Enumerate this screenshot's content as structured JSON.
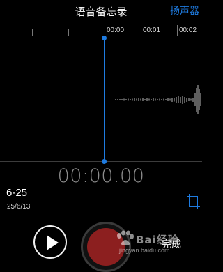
{
  "header": {
    "title": "语音备忘录",
    "speaker_label": "扬声器"
  },
  "timeline": {
    "ticks": [
      "00:00",
      "00:01",
      "00:02"
    ]
  },
  "recording": {
    "timer": "00:00.00"
  },
  "memo": {
    "name": "6-25",
    "date": "25/6/13"
  },
  "controls": {
    "done_label": "完成"
  },
  "watermark": {
    "text": "Bai经验",
    "url": "jingyan.baidu.com"
  },
  "colors": {
    "accent": "#1e7be0",
    "record": "#8c1f1f",
    "background": "#000000"
  },
  "icons": [
    "play-icon",
    "record-icon",
    "crop-icon",
    "playhead-handle-icon"
  ]
}
